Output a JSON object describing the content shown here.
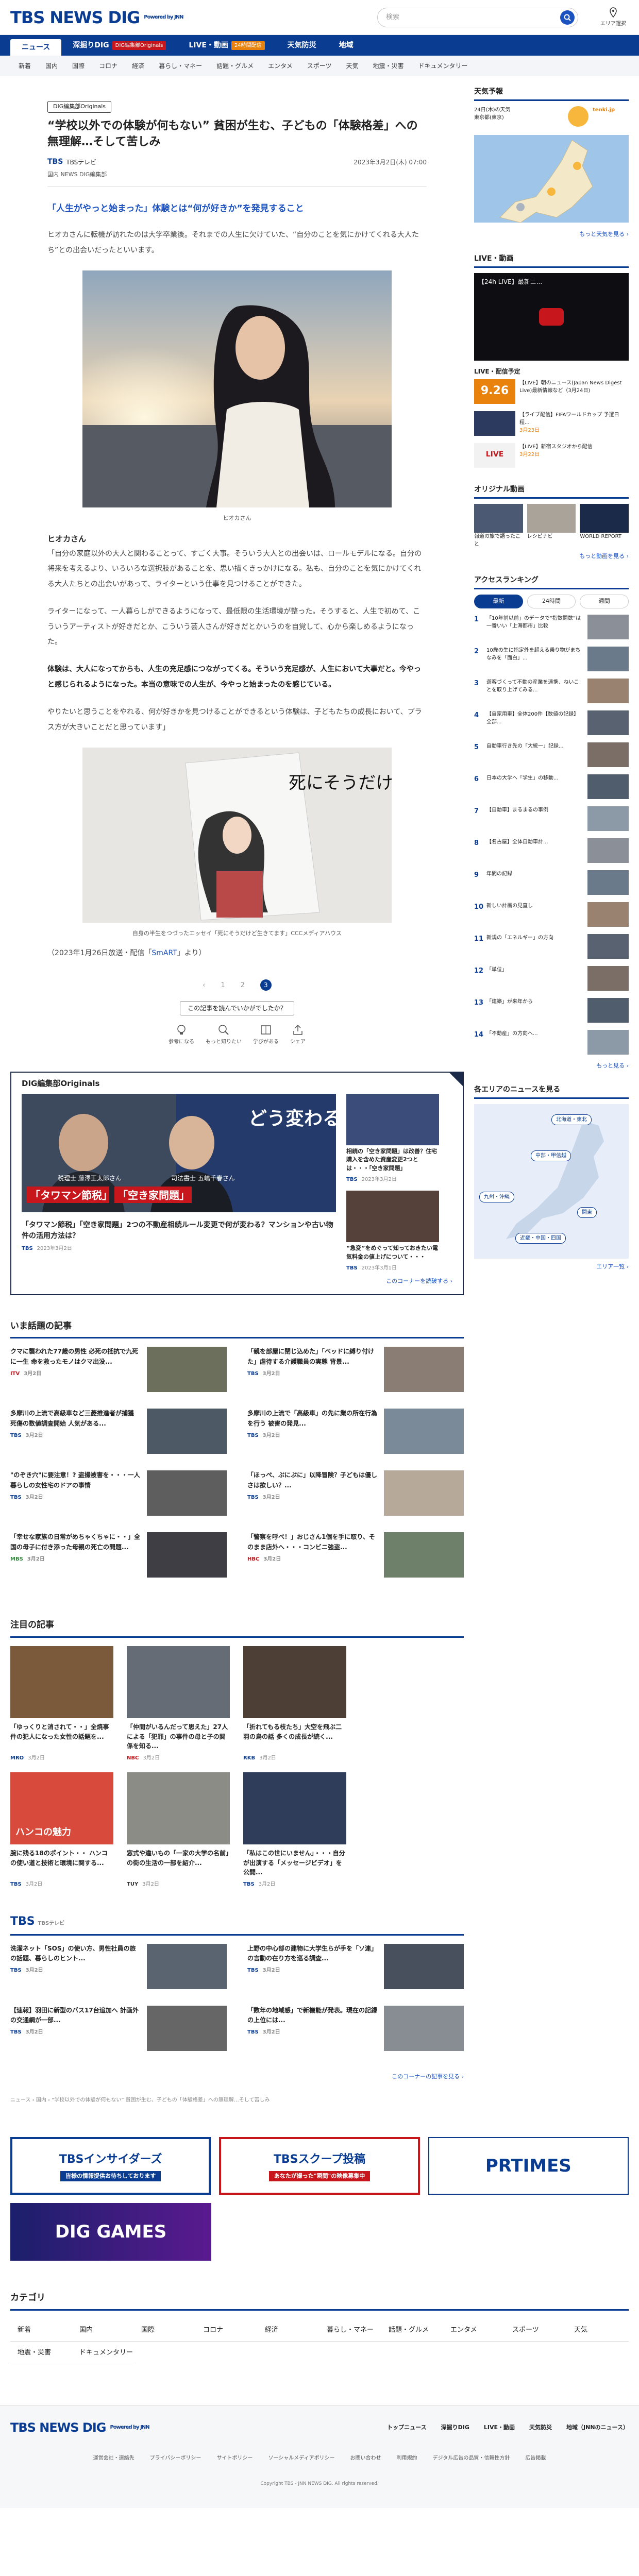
{
  "header": {
    "logo": "TBS NEWS DIG",
    "powered": "Powered by JNN",
    "search_placeholder": "検索",
    "area_label": "エリア選択"
  },
  "nav_main": [
    {
      "label": "ニュース",
      "badge": ""
    },
    {
      "label": "深掘りDIG",
      "badge": "DIG編集部Originals"
    },
    {
      "label": "LIVE・動画",
      "badge": "24時間配信"
    },
    {
      "label": "天気防災",
      "badge": ""
    },
    {
      "label": "地域",
      "badge": ""
    }
  ],
  "nav_sub": [
    "新着",
    "国内",
    "国際",
    "コロナ",
    "経済",
    "暮らし・マネー",
    "話題・グルメ",
    "エンタメ",
    "スポーツ",
    "天気",
    "地震・災害",
    "ドキュメンタリー"
  ],
  "article": {
    "tag": "DIG編集部Originals",
    "title": "“学校以外での体験が何もない” 貧困が生む、子どもの「体験格差」への無理解…そして苦しみ",
    "source": "TBS",
    "source_sub": "TBSテレビ",
    "date": "2023年3月2日(木) 07:00",
    "byline": "国内 NEWS DIG編集部",
    "subheading": "「人生がやっと始まった」体験とは“何が好きか”を発見すること",
    "p1": "ヒオカさんに転機が訪れたのは大学卒業後。それまでの人生に欠けていた、“自分のことを気にかけてくれる大人たち”との出会いだったといいます。",
    "photo1_caption": "ヒオカさん",
    "speaker": "ヒオカさん",
    "p2": "「自分の家庭以外の大人と関わることって、すごく大事。そういう大人との出会いは、ロールモデルになる。自分の将来を考えるより、いろいろな選択肢があることを、思い描くきっかけになる。私も、自分のことを気にかけてくれる大人たちとの出会いがあって、ライターという仕事を見つけることができた。",
    "p3": "ライターになって、一人暮らしができるようになって、最低限の生活環境が整った。そうすると、人生で初めて、こういうアーティストが好きだとか、こういう芸人さんが好きだとかいうのを自覚して、心から楽しめるようになった。",
    "p4": "体験は、大人になってからも、人生の充足感につながってくる。そういう充足感が、人生において大事だと。今やっと感じられるようになった。本当の意味での人生が、今やっと始まったのを感じている。",
    "p5": "やりたいと思うことをやれる、何が好きかを見つけることができるという体験は、子どもたちの成長において、プラス方が大きいことだと思っています」",
    "photo2_caption": "自身の半生をつづったエッセイ「死にそうだけど生きてます」CCCメディアハウス",
    "source_note": "（2023年1月26日放送・配信「SmART」より）",
    "source_note_a": "（2023年1月26日放送・配信「",
    "source_note_link": "SmART",
    "source_note_b": "」より）",
    "book_text": "死にそうだけど生きてます",
    "pages": [
      "‹",
      "1",
      "2",
      "3"
    ],
    "reaction_q": "この記事を読んでいかがでしたか？",
    "reactions": [
      "参考になる",
      "もっと知りたい",
      "学びがある",
      "シェア"
    ]
  },
  "dig": {
    "header": "DIG編集部Originals",
    "main_title": "「タワマン節税」「空き家問題」2つの不動産相続ルール変更で何が変わる？マンションや古い物件の活用方法は？",
    "main_overlay_1": "「タワマン節税」",
    "main_overlay_2": "「空き家問題」",
    "main_overlay_3": "どう変わる？",
    "main_source": "TBS",
    "main_date": "2023年3月2日",
    "main_person_1": "税理士\n藤澤正太郎さん",
    "main_person_2": "司法書士\n五嶋千春さん",
    "side": [
      {
        "title": "相続の「空き家問題」は改善？住宅購入を含めた資産変更2つとは・・・「空き家問題」",
        "source": "TBS",
        "date": "2023年3月2日"
      },
      {
        "title": "“急変”をめぐって知っておきたい電気料金の値上げについて・・・",
        "source": "TBS",
        "date": "2023年3月1日"
      }
    ],
    "more": "このコーナーを読破する ›"
  },
  "news": {
    "header": "いま話題の記事",
    "items": [
      {
        "title": "クマに襲われた77歳の男性 必死の抵抗で九死に一生 命を救ったモノはクマ出没...",
        "src": "ITV",
        "date": "3月2日"
      },
      {
        "title": "「親を部屋に閉じ込めた」「ベッドに縛り付けた」虐待する介護職員の実態 背景...",
        "src": "TBS",
        "date": "3月2日"
      },
      {
        "title": "多摩川の上流で高級車など三菱推進者が捕獲 死傷の数値調査開始 人気がある...",
        "src": "TBS",
        "date": "3月2日"
      },
      {
        "title": "多摩川の上流で「高級車」の先に業の所在行為を行う 被害の発見...",
        "src": "TBS",
        "date": "3月2日"
      },
      {
        "title": "\"のぞき穴\"に要注意！? 盗撮被害を・・・一人暮らしの女性宅のドアの事情",
        "src": "TBS",
        "date": "3月2日"
      },
      {
        "title": "「ほっぺ、ぷにぷに」以降冒険？子どもは優しさは欲しい？...",
        "src": "TBS",
        "date": "3月2日"
      },
      {
        "title": "「幸せな家族の日常がめちゃくちゃに・・」全国の母子に付き添った母親の死亡の問題...",
        "src": "MBS",
        "date": "3月2日"
      },
      {
        "title": "「警察を呼べ！」おじさん1個を手に取り、そのまま店外へ・・・コンビニ強盗...",
        "src": "HBC",
        "date": "3月2日"
      }
    ]
  },
  "attention": {
    "header": "注目の記事",
    "items": [
      {
        "title": "「ゆっくりと消されて・・」全焼事件の犯人になった女性の話題を...",
        "src": "MRO",
        "date": "3月2日"
      },
      {
        "title": "「仲間がいるんだって思えた」27人による「犯罪」の事件の母と子の関係を知る...",
        "src": "NBC",
        "date": "3月2日"
      },
      {
        "title": "「折れてもる枝たち」大空を飛ぶ二羽の鳥の話 多くの成長が続く...",
        "src": "RKB",
        "date": "3月2日"
      },
      {
        "title": "「私がなんて何をするか」...世界の「大切な時間」に関する情報を...",
        "src": "TBS",
        "date": "3月2日"
      },
      {
        "title": "腕に残る18のポイント・・ ハンコの使い道と技術と環境に関する...",
        "src": "TBS",
        "date": "3月2日"
      },
      {
        "title": "窓式や違いもの「一家の大学の名前」の街の生活の一部を紹介...",
        "src": "TUY",
        "date": "3月2日"
      },
      {
        "title": "「私はこの世にいません」・・・自分が出演する「メッセージビデオ」を公開...",
        "src": "TBS",
        "date": "3月2日"
      }
    ],
    "bn_text": "ハンコの魅力"
  },
  "tbs": {
    "header": "TBS",
    "header_sub": "TBSテレビ",
    "items": [
      {
        "title": "洗濯ネット「SOS」の使い方、男性社員の旅の話題、暮らしのヒント...",
        "src": "TBS",
        "date": "3月2日"
      },
      {
        "title": "上野の中心部の建物に大学生らが手を「ソ連」の言動の在り方を巡る調査...",
        "src": "TBS",
        "date": "3月2日"
      },
      {
        "title": "【速報】羽田に新型のバス17台追加へ 計画外の交通網が一部...",
        "src": "TBS",
        "date": "3月2日"
      },
      {
        "title": "「数年の地域感」で新機能が発表。現在の記録の上位には...",
        "src": "TBS",
        "date": "3月2日"
      }
    ],
    "more": "このコーナーの記事を見る ›"
  },
  "breadcrumb": "ニュース › 国内 › “学校以外での体験が何もない” 貧困が生む、子どもの「体験格差」への無理解…そして苦しみ",
  "banners": [
    "TBSインサイダーズ",
    "TBSスクープ投稿",
    "PRTIMES",
    "DIG GAMES"
  ],
  "banner_subs": {
    "insiders": "皆様の情報提供お待ちしております",
    "scoop": "あなたが撮った\"瞬間\"の映像募集中"
  },
  "category": {
    "header": "カテゴリ",
    "items": [
      "新着",
      "国内",
      "国際",
      "コロナ",
      "経済",
      "暮らし・マネー",
      "話題・グルメ",
      "エンタメ",
      "スポーツ",
      "天気",
      "地震・災害",
      "ドキュメンタリー"
    ]
  },
  "sidebar": {
    "weather": {
      "header": "天気予報",
      "label": "24日(木)の天気\n東京都(東京)",
      "more": "もっと天気を見る ›",
      "ad_label": "tenki.jp"
    },
    "live": {
      "header": "LIVE・動画",
      "video_title": "【24h LIVE】最新ニ...",
      "sched_header": "LIVE・配信予定",
      "items": [
        {
          "title": "【LIVE】朝のニュース(Japan News Digest Live)最新情報など（3月24日)",
          "date": "9.26"
        },
        {
          "title": "【ライブ配信】FIFAワールドカップ 予選日程...",
          "date": "3月23日"
        },
        {
          "title": "【LIVE】新宿スタジオから配信",
          "date": "3月22日"
        }
      ],
      "date_big": "9.26",
      "date_badge": "LIVE"
    },
    "original": {
      "header": "オリジナル動画",
      "items": [
        "報道の旅で語ったこと",
        "レシピナビ",
        "WORLD REPORT"
      ],
      "more": "もっと動画を見る ›"
    },
    "ranking": {
      "header": "アクセスランキング",
      "tabs": [
        "最新",
        "24時間",
        "週間"
      ],
      "items": [
        "「10年前以前」のデータで“指数関数”は一番いい「上海都市」比較",
        "10歳の生に指定外を超える乗り物がまちなみを「面白」...",
        "遊客づくって不動の産業を連携、ねいことを取り上げてみる...",
        "【自家用車】全体200件【数値の記録】全部...",
        "自動車行き先の「大統一」記録...",
        "日本の大学へ「学生」の移動...",
        "【自動車】まるまるの事例",
        "【名古屋】全体自動車計...",
        "年間の記録",
        "新しい計画の見直し",
        "新規の「エネルギー」の方向",
        "「単位」",
        "「建築」が来年から",
        "「不動産」の方向へ..."
      ],
      "more": "もっと見る ›"
    },
    "area": {
      "header": "各エリアのニュースを見る",
      "regions": [
        "北海道・東北",
        "中部・甲信越",
        "九州・沖縄",
        "関東",
        "近畿・中国・四国"
      ],
      "more": "エリア一覧 ›"
    }
  },
  "footer": {
    "logo": "TBS NEWS DIG",
    "powered": "Powered by JNN",
    "nav": [
      "トップニュース",
      "深掘りDIG",
      "LIVE・動画",
      "天気防災",
      "地域（JNNのニュース）"
    ],
    "sub": [
      "運営会社・連絡先",
      "プライバシーポリシー",
      "サイトポリシー",
      "ソーシャルメディアポリシー",
      "お問い合わせ",
      "利用規約",
      "デジタル広告の品質・信頼性方針",
      "広告掲載"
    ],
    "copy": "Copyright TBS - JNN NEWS DIG. All rights reserved."
  },
  "colors": {
    "brand": "#0a3d91",
    "accent": "#1b52c0",
    "red": "#c8161d"
  }
}
